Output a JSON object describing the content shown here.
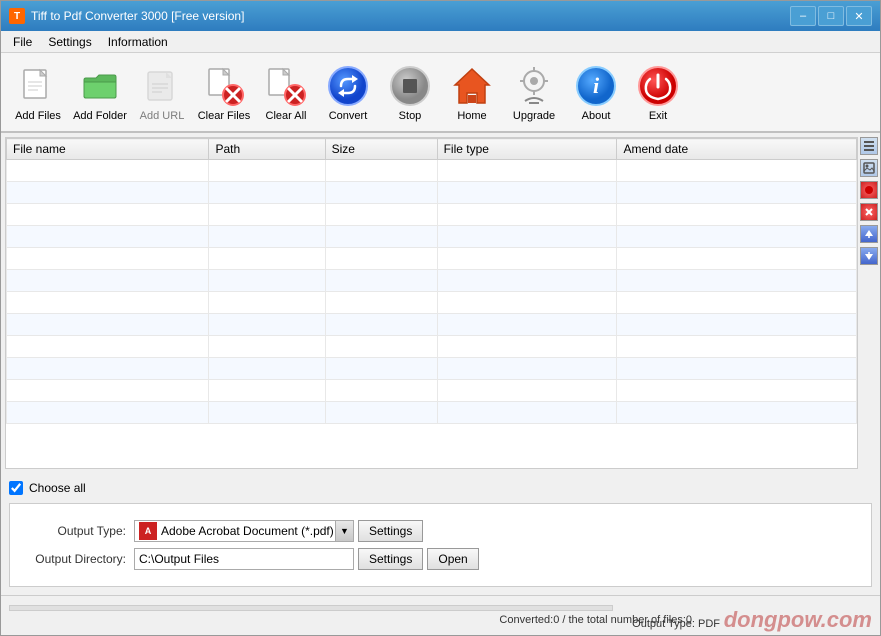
{
  "window": {
    "title": "Tiff to Pdf Converter 3000 [Free version]",
    "title_icon": "T"
  },
  "title_buttons": {
    "minimize": "–",
    "maximize": "□",
    "close": "✕"
  },
  "menu": {
    "items": [
      "File",
      "Settings",
      "Information"
    ]
  },
  "toolbar": {
    "buttons": [
      {
        "id": "add-files",
        "label": "Add Files",
        "icon": "add-files-icon"
      },
      {
        "id": "add-folder",
        "label": "Add Folder",
        "icon": "add-folder-icon"
      },
      {
        "id": "add-url",
        "label": "Add URL",
        "icon": "add-url-icon",
        "disabled": true
      },
      {
        "id": "clear-files",
        "label": "Clear Files",
        "icon": "clear-files-icon"
      },
      {
        "id": "clear-all",
        "label": "Clear All",
        "icon": "clear-all-icon"
      },
      {
        "id": "convert",
        "label": "Convert",
        "icon": "convert-icon"
      },
      {
        "id": "stop",
        "label": "Stop",
        "icon": "stop-icon"
      },
      {
        "id": "home",
        "label": "Home",
        "icon": "home-icon"
      },
      {
        "id": "upgrade",
        "label": "Upgrade",
        "icon": "upgrade-icon"
      },
      {
        "id": "about",
        "label": "About",
        "icon": "about-icon"
      },
      {
        "id": "exit",
        "label": "Exit",
        "icon": "exit-icon"
      }
    ]
  },
  "table": {
    "columns": [
      "File name",
      "Path",
      "Size",
      "File type",
      "Amend date"
    ],
    "rows": []
  },
  "sidebar_actions": [
    {
      "id": "list-icon",
      "symbol": "≡"
    },
    {
      "id": "image-icon",
      "symbol": "🖼"
    },
    {
      "id": "minus-icon",
      "symbol": "●"
    },
    {
      "id": "x-icon",
      "symbol": "✕"
    },
    {
      "id": "up-icon",
      "symbol": "▲"
    },
    {
      "id": "down-icon",
      "symbol": "▼"
    }
  ],
  "bottom": {
    "choose_all_label": "Choose all",
    "choose_all_checked": true
  },
  "settings_panel": {
    "output_type_label": "Output Type:",
    "output_type_value": "Adobe Acrobat Document (*.pdf)",
    "output_type_icon": "pdf",
    "settings_btn_label": "Settings",
    "output_dir_label": "Output Directory:",
    "output_dir_value": "C:\\Output Files",
    "output_dir_settings_label": "Settings",
    "open_btn_label": "Open"
  },
  "status": {
    "progress_text": "Converted:0  /  the total number of files:0",
    "output_type_text": "Output Type:  PDF",
    "watermark": "dongpow.com"
  }
}
